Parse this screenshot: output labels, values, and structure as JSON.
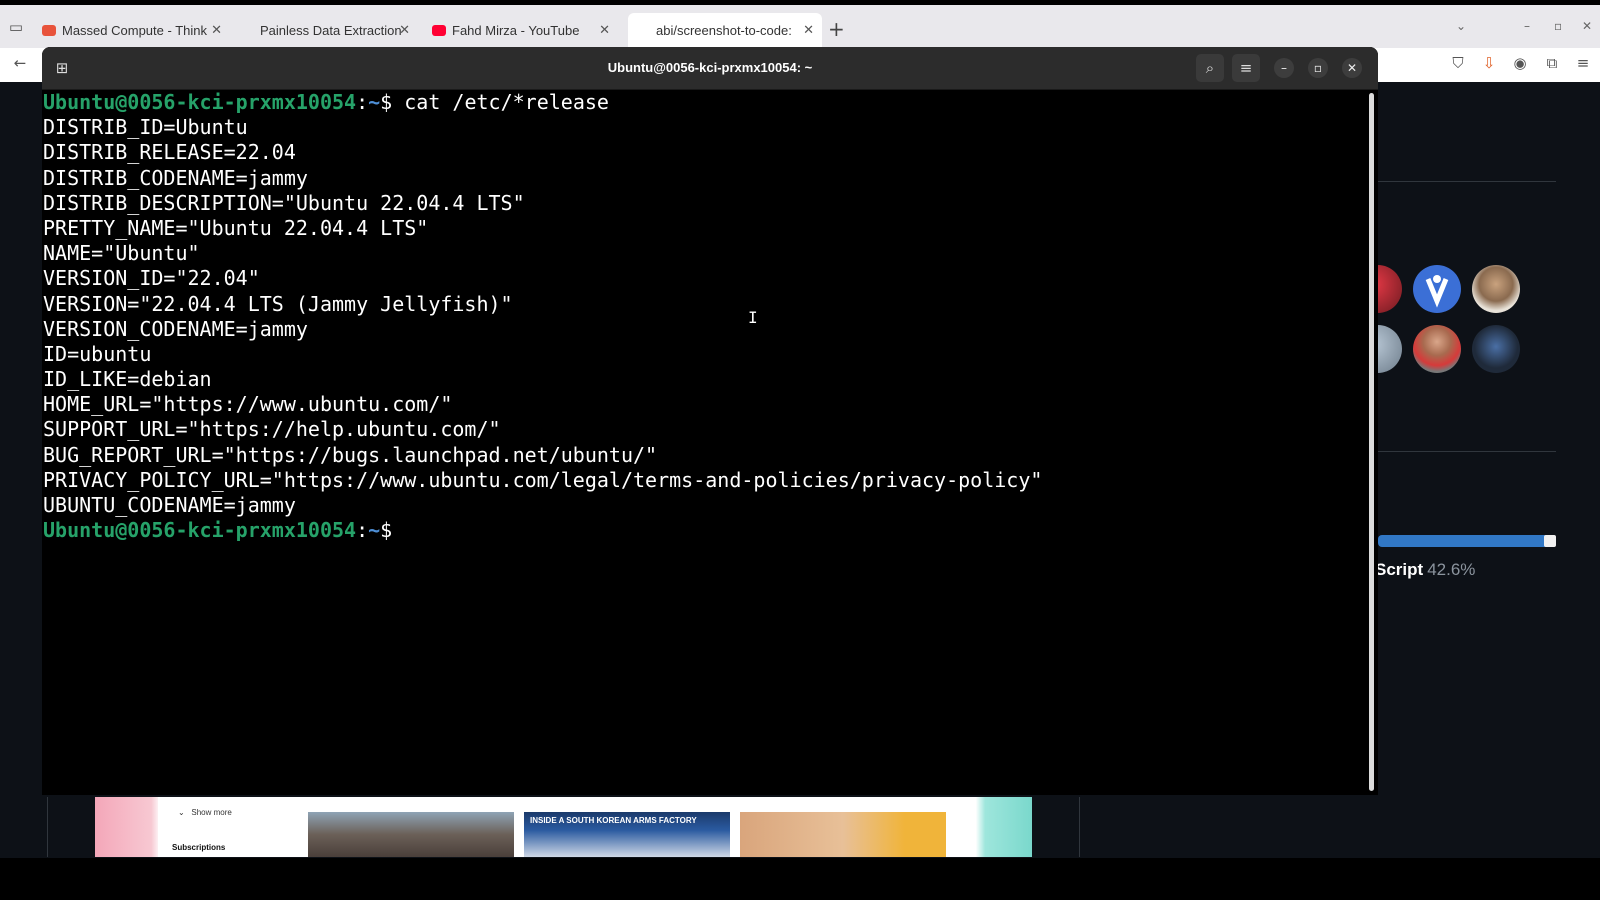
{
  "browser": {
    "tabs": [
      {
        "label": "Massed Compute - Think",
        "favicon_color": "#e8533b"
      },
      {
        "label": "Painless Data Extraction",
        "favicon_color": "#e9e8ec"
      },
      {
        "label": "Fahd Mirza - YouTube",
        "favicon_color": "#ff0033"
      },
      {
        "label": "abi/screenshot-to-code: ",
        "favicon_color": "#e9e8ec"
      }
    ],
    "new_tab_label": "+"
  },
  "terminal": {
    "title": "Ubuntu@0056-kci-prxmx10054: ~",
    "prompt_user": "Ubuntu@0056-kci-prxmx10054",
    "prompt_sep": ":",
    "prompt_path": "~",
    "prompt_symbol": "$",
    "command": " cat /etc/*release",
    "output": [
      "DISTRIB_ID=Ubuntu",
      "DISTRIB_RELEASE=22.04",
      "DISTRIB_CODENAME=jammy",
      "DISTRIB_DESCRIPTION=\"Ubuntu 22.04.4 LTS\"",
      "PRETTY_NAME=\"Ubuntu 22.04.4 LTS\"",
      "NAME=\"Ubuntu\"",
      "VERSION_ID=\"22.04\"",
      "VERSION=\"22.04.4 LTS (Jammy Jellyfish)\"",
      "VERSION_CODENAME=jammy",
      "ID=ubuntu",
      "ID_LIKE=debian",
      "HOME_URL=\"https://www.ubuntu.com/\"",
      "SUPPORT_URL=\"https://help.ubuntu.com/\"",
      "BUG_REPORT_URL=\"https://bugs.launchpad.net/ubuntu/\"",
      "PRIVACY_POLICY_URL=\"https://www.ubuntu.com/legal/terms-and-policies/privacy-policy\"",
      "UBUNTU_CODENAME=jammy"
    ],
    "colors": {
      "user": "#26a269",
      "path": "#4e8fd6",
      "background": "#000000",
      "header": "#2c2c2c"
    }
  },
  "github_sidebar": {
    "language_name": "Script",
    "language_percent": "42.6%",
    "language_fraction": 0.426
  },
  "youtube": {
    "show_more": "Show more",
    "subscriptions": "Subscriptions",
    "thumb_caption": "INSIDE A SOUTH KOREAN ARMS FACTORY"
  }
}
